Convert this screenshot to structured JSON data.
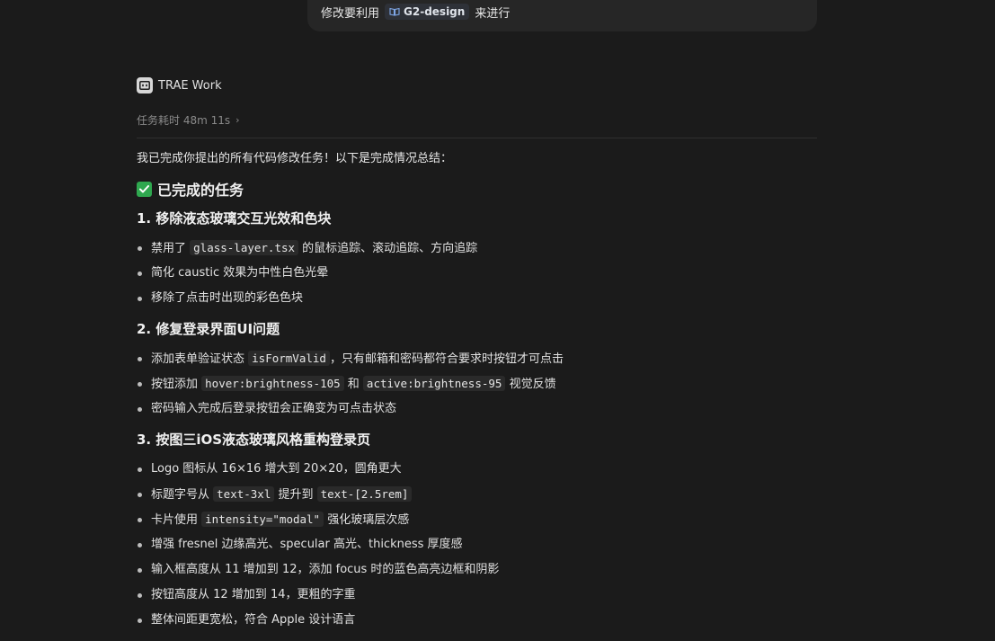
{
  "user_message": {
    "prefix": "修改要利用",
    "reference": "G2-design",
    "suffix": "来进行"
  },
  "agent": {
    "name": "TRAE Work",
    "duration": "任务耗时 48m 11s"
  },
  "response": {
    "intro": "我已完成你提出的所有代码修改任务！以下是完成情况总结：",
    "heading": "已完成的任务",
    "sections": [
      {
        "title": "1. 移除液态玻璃交互光效和色块",
        "items": [
          {
            "parts": [
              {
                "t": "禁用了 "
              },
              {
                "c": "glass-layer.tsx"
              },
              {
                "t": " 的鼠标追踪、滚动追踪、方向追踪"
              }
            ]
          },
          {
            "parts": [
              {
                "t": "简化 caustic 效果为中性白色光晕"
              }
            ]
          },
          {
            "parts": [
              {
                "t": "移除了点击时出现的彩色色块"
              }
            ]
          }
        ]
      },
      {
        "title": "2. 修复登录界面UI问题",
        "items": [
          {
            "parts": [
              {
                "t": "添加表单验证状态 "
              },
              {
                "c": "isFormValid"
              },
              {
                "t": "，只有邮箱和密码都符合要求时按钮才可点击"
              }
            ]
          },
          {
            "parts": [
              {
                "t": "按钮添加 "
              },
              {
                "c": "hover:brightness-105"
              },
              {
                "t": " 和 "
              },
              {
                "c": "active:brightness-95"
              },
              {
                "t": " 视觉反馈"
              }
            ]
          },
          {
            "parts": [
              {
                "t": "密码输入完成后登录按钮会正确变为可点击状态"
              }
            ]
          }
        ]
      },
      {
        "title": "3. 按图三iOS液态玻璃风格重构登录页",
        "items": [
          {
            "parts": [
              {
                "t": "Logo 图标从 16×16 增大到 20×20，圆角更大"
              }
            ]
          },
          {
            "parts": [
              {
                "t": "标题字号从 "
              },
              {
                "c": "text-3xl"
              },
              {
                "t": " 提升到 "
              },
              {
                "c": "text-[2.5rem]"
              }
            ]
          },
          {
            "parts": [
              {
                "t": "卡片使用 "
              },
              {
                "c": "intensity=\"modal\""
              },
              {
                "t": " 强化玻璃层次感"
              }
            ]
          },
          {
            "parts": [
              {
                "t": "增强 fresnel 边缘高光、specular 高光、thickness 厚度感"
              }
            ]
          },
          {
            "parts": [
              {
                "t": "输入框高度从 11 增加到 12，添加 focus 时的蓝色高亮边框和阴影"
              }
            ]
          },
          {
            "parts": [
              {
                "t": "按钮高度从 12 增加到 14，更粗的字重"
              }
            ]
          },
          {
            "parts": [
              {
                "t": "整体间距更宽松，符合 Apple 设计语言"
              }
            ]
          }
        ]
      }
    ]
  },
  "icons": {
    "reference": "book-icon",
    "agent": "trae-logo-icon",
    "duration_chevron": "chevron-right-icon",
    "heading": "check-mark-icon"
  },
  "colors": {
    "background": "#1b1b1b",
    "bubble": "#262626",
    "check_green": "#2fa84f"
  }
}
